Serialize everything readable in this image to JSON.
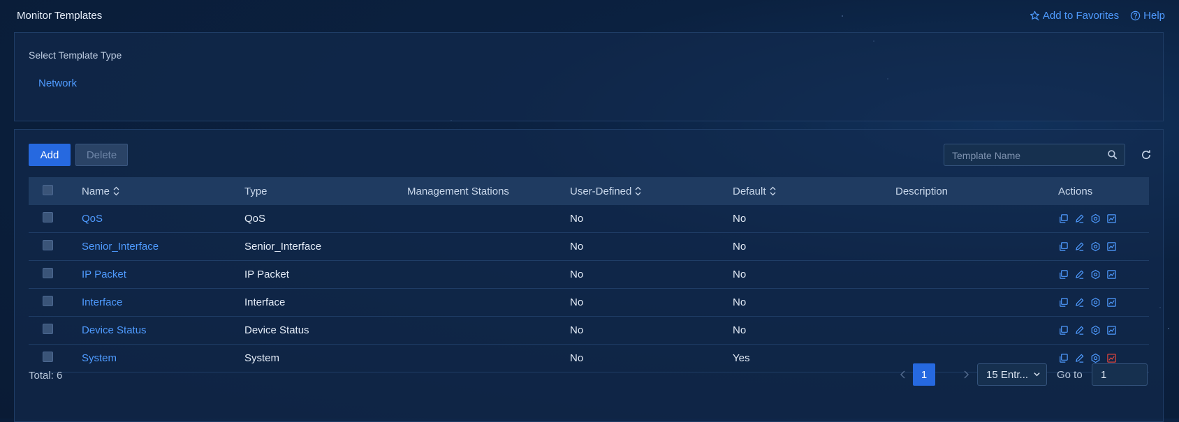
{
  "header": {
    "title": "Monitor Templates",
    "add_favorites": "Add to Favorites",
    "help": "Help"
  },
  "type_panel": {
    "label": "Select Template Type",
    "options": [
      "Network"
    ]
  },
  "toolbar": {
    "add_label": "Add",
    "delete_label": "Delete",
    "search_placeholder": "Template Name",
    "search_value": ""
  },
  "table": {
    "columns": [
      "Name",
      "Type",
      "Management Stations",
      "User-Defined",
      "Default",
      "Description",
      "Actions"
    ],
    "rows": [
      {
        "name": "QoS",
        "type": "QoS",
        "mgmt": "",
        "user_defined": "No",
        "default": "No",
        "description": "",
        "chart_alert": false
      },
      {
        "name": "Senior_Interface",
        "type": "Senior_Interface",
        "mgmt": "",
        "user_defined": "No",
        "default": "No",
        "description": "",
        "chart_alert": false
      },
      {
        "name": "IP Packet",
        "type": "IP Packet",
        "mgmt": "",
        "user_defined": "No",
        "default": "No",
        "description": "",
        "chart_alert": false
      },
      {
        "name": "Interface",
        "type": "Interface",
        "mgmt": "",
        "user_defined": "No",
        "default": "No",
        "description": "",
        "chart_alert": false
      },
      {
        "name": "Device Status",
        "type": "Device Status",
        "mgmt": "",
        "user_defined": "No",
        "default": "No",
        "description": "",
        "chart_alert": false
      },
      {
        "name": "System",
        "type": "System",
        "mgmt": "",
        "user_defined": "No",
        "default": "Yes",
        "description": "",
        "chart_alert": true
      }
    ]
  },
  "footer": {
    "total": "Total: 6",
    "current_page": "1",
    "page_size": "15 Entr...",
    "goto_label": "Go to",
    "goto_value": "1"
  },
  "icons": {
    "action_icons": [
      "copy-icon",
      "edit-icon",
      "settings-icon",
      "chart-icon"
    ]
  },
  "colors": {
    "accent": "#2669e0",
    "link": "#4f9bff",
    "alert_icon": "#e0453d"
  }
}
